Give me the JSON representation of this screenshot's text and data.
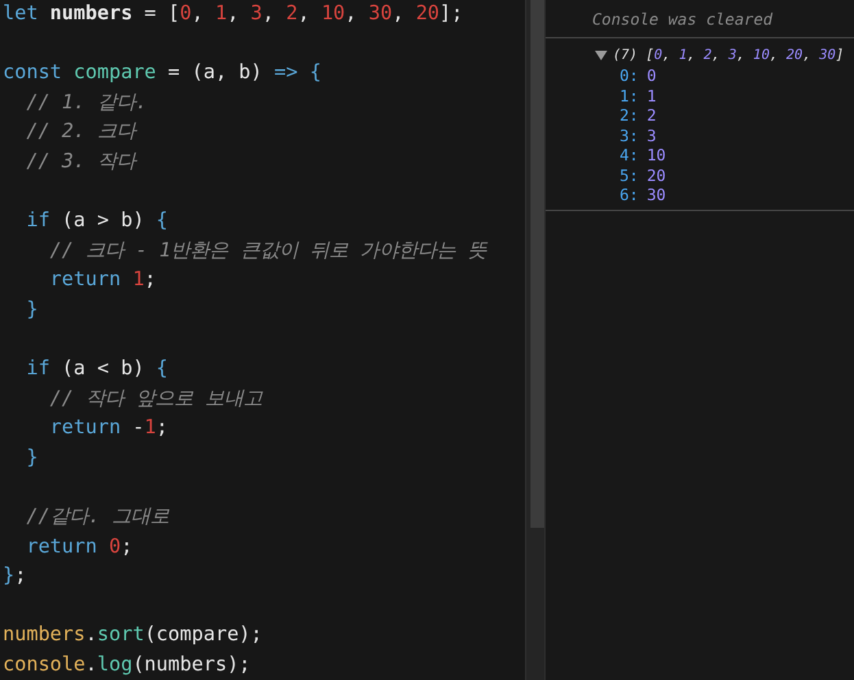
{
  "editor": {
    "lines": [
      {
        "kind": "code",
        "tokens": [
          {
            "kind": "kw",
            "text": "let"
          },
          {
            "kind": "var",
            "text": " numbers"
          },
          {
            "kind": "op",
            "text": " = ["
          },
          {
            "kind": "num",
            "text": "0"
          },
          {
            "kind": "op",
            "text": ", "
          },
          {
            "kind": "num",
            "text": "1"
          },
          {
            "kind": "op",
            "text": ", "
          },
          {
            "kind": "num",
            "text": "3"
          },
          {
            "kind": "op",
            "text": ", "
          },
          {
            "kind": "num",
            "text": "2"
          },
          {
            "kind": "op",
            "text": ", "
          },
          {
            "kind": "num",
            "text": "10"
          },
          {
            "kind": "op",
            "text": ", "
          },
          {
            "kind": "num",
            "text": "30"
          },
          {
            "kind": "op",
            "text": ", "
          },
          {
            "kind": "num",
            "text": "20"
          },
          {
            "kind": "op",
            "text": "];"
          }
        ]
      },
      {
        "kind": "blank"
      },
      {
        "kind": "code",
        "tokens": [
          {
            "kind": "kw",
            "text": "const"
          },
          {
            "kind": "fn",
            "text": " compare"
          },
          {
            "kind": "op",
            "text": " = (a, b) "
          },
          {
            "kind": "kw",
            "text": "=> {"
          }
        ]
      },
      {
        "kind": "code",
        "tokens": [
          {
            "kind": "cmt",
            "text": "  // 1. 같다."
          }
        ]
      },
      {
        "kind": "code",
        "tokens": [
          {
            "kind": "cmt",
            "text": "  // 2. 크다"
          }
        ]
      },
      {
        "kind": "code",
        "tokens": [
          {
            "kind": "cmt",
            "text": "  // 3. 작다"
          }
        ]
      },
      {
        "kind": "blank"
      },
      {
        "kind": "code",
        "tokens": [
          {
            "kind": "kw",
            "text": "  if"
          },
          {
            "kind": "op",
            "text": " (a > b) "
          },
          {
            "kind": "kw",
            "text": "{"
          }
        ]
      },
      {
        "kind": "code",
        "tokens": [
          {
            "kind": "cmt",
            "text": "    // 크다 - 1반환은 큰값이 뒤로 가야한다는 뜻"
          }
        ]
      },
      {
        "kind": "code",
        "tokens": [
          {
            "kind": "kw",
            "text": "    return "
          },
          {
            "kind": "num",
            "text": "1"
          },
          {
            "kind": "op",
            "text": ";"
          }
        ]
      },
      {
        "kind": "code",
        "tokens": [
          {
            "kind": "kw",
            "text": "  }"
          }
        ]
      },
      {
        "kind": "blank"
      },
      {
        "kind": "code",
        "tokens": [
          {
            "kind": "kw",
            "text": "  if"
          },
          {
            "kind": "op",
            "text": " (a < b) "
          },
          {
            "kind": "kw",
            "text": "{"
          }
        ]
      },
      {
        "kind": "code",
        "tokens": [
          {
            "kind": "cmt",
            "text": "    // 작다 앞으로 보내고"
          }
        ]
      },
      {
        "kind": "code",
        "tokens": [
          {
            "kind": "kw",
            "text": "    return"
          },
          {
            "kind": "op",
            "text": " -"
          },
          {
            "kind": "num",
            "text": "1"
          },
          {
            "kind": "op",
            "text": ";"
          }
        ]
      },
      {
        "kind": "code",
        "tokens": [
          {
            "kind": "kw",
            "text": "  }"
          }
        ]
      },
      {
        "kind": "blank"
      },
      {
        "kind": "code",
        "tokens": [
          {
            "kind": "cmt",
            "text": "  //같다. 그대로"
          }
        ]
      },
      {
        "kind": "code",
        "tokens": [
          {
            "kind": "kw",
            "text": "  return "
          },
          {
            "kind": "num",
            "text": "0"
          },
          {
            "kind": "op",
            "text": ";"
          }
        ]
      },
      {
        "kind": "code",
        "tokens": [
          {
            "kind": "kw",
            "text": "}"
          },
          {
            "kind": "op",
            "text": ";"
          }
        ]
      },
      {
        "kind": "blank"
      },
      {
        "kind": "code",
        "tokens": [
          {
            "kind": "obj",
            "text": "numbers"
          },
          {
            "kind": "op",
            "text": "."
          },
          {
            "kind": "fn",
            "text": "sort"
          },
          {
            "kind": "op",
            "text": "(compare);"
          }
        ]
      },
      {
        "kind": "code",
        "tokens": [
          {
            "kind": "obj",
            "text": "console"
          },
          {
            "kind": "op",
            "text": "."
          },
          {
            "kind": "fn",
            "text": "log"
          },
          {
            "kind": "op",
            "text": "(numbers);"
          }
        ]
      }
    ]
  },
  "console": {
    "message": "Console was cleared",
    "array": {
      "expanded": true,
      "preview": [
        {
          "kind": "op",
          "text": "(7) ["
        },
        {
          "kind": "num",
          "text": "0"
        },
        {
          "kind": "op",
          "text": ", "
        },
        {
          "kind": "num",
          "text": "1"
        },
        {
          "kind": "op",
          "text": ", "
        },
        {
          "kind": "num",
          "text": "2"
        },
        {
          "kind": "op",
          "text": ", "
        },
        {
          "kind": "num",
          "text": "3"
        },
        {
          "kind": "op",
          "text": ", "
        },
        {
          "kind": "num",
          "text": "10"
        },
        {
          "kind": "op",
          "text": ", "
        },
        {
          "kind": "num",
          "text": "20"
        },
        {
          "kind": "op",
          "text": ", "
        },
        {
          "kind": "num",
          "text": "30"
        },
        {
          "kind": "op",
          "text": "]"
        }
      ],
      "items": [
        {
          "index": "0:",
          "value": "0"
        },
        {
          "index": "1:",
          "value": "1"
        },
        {
          "index": "2:",
          "value": "2"
        },
        {
          "index": "3:",
          "value": "3"
        },
        {
          "index": "4:",
          "value": "10"
        },
        {
          "index": "5:",
          "value": "20"
        },
        {
          "index": "6:",
          "value": "30"
        }
      ]
    }
  }
}
